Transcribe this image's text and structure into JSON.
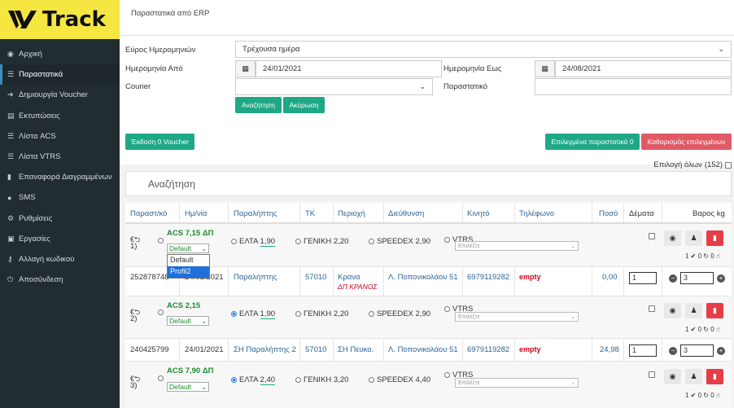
{
  "brand": {
    "name": "Track"
  },
  "nav": [
    {
      "icon": "tachometer-icon",
      "label": "Αρχική",
      "active": false
    },
    {
      "icon": "list-icon",
      "label": "Παραστατικά",
      "active": true
    },
    {
      "icon": "arrow-icon",
      "label": "Δημιουργία Voucher",
      "active": false
    },
    {
      "icon": "printer-icon",
      "label": "Εκτυπώσεις",
      "active": false
    },
    {
      "icon": "list-icon",
      "label": "Λίστα ACS",
      "active": false
    },
    {
      "icon": "list-icon",
      "label": "Λίστα VTRS",
      "active": false
    },
    {
      "icon": "trash-icon",
      "label": "Επαναφορά Διαγραμμένων",
      "active": false
    },
    {
      "icon": "comment-icon",
      "label": "SMS",
      "active": false
    },
    {
      "icon": "sliders-icon",
      "label": "Ρυθμίσεις",
      "active": false
    },
    {
      "icon": "briefcase-icon",
      "label": "Εργασίες",
      "active": false
    },
    {
      "icon": "key-icon",
      "label": "Αλλαγή κωδικού",
      "active": false
    },
    {
      "icon": "power-icon",
      "label": "Αποσύνδεση",
      "active": false
    }
  ],
  "page": {
    "title": "Παραστατικά από ERP"
  },
  "filters": {
    "range_label": "Εύρος Ημερομηνιών",
    "range_value": "Τρέχουσα ημέρα",
    "from_label": "Ημερομηνία Από",
    "from_value": "24/01/2021",
    "to_label": "Ημερομηνία Εως",
    "to_value": "24/08/2021",
    "courier_label": "Courier",
    "courier_value": "",
    "doc_label": "Παραστατικό",
    "doc_value": "",
    "search_btn": "Αναζήτηση",
    "cancel_btn": "Ακύρωση"
  },
  "actions": {
    "issue": "Έκδοση 0 Voucher",
    "selected": "Επιλεγμένα παραστατικά 0",
    "clear": "Καθαρισμός επιλεγμένων"
  },
  "select_all": {
    "label": "Επιλογή όλων",
    "count": "(152)"
  },
  "search": {
    "placeholder": "Αναζήτηση"
  },
  "table": {
    "headers": [
      "Παραστ/κό",
      "Ημ/νία",
      "Παραλήπτης",
      "ΤΚ",
      "Περιοχή",
      "Διεύθυνση",
      "Κινητό",
      "Τηλέφωνο",
      "Ποσό",
      "Δέματα",
      "Βαρος kg"
    ],
    "rows": [
      {
        "num": "1)",
        "offer": "ACS 7,15 ΔΠ",
        "profile": "Default",
        "couriers": [
          {
            "name": "ΕΛΤΑ",
            "price": "1,90",
            "on": false
          },
          {
            "name": "ΓΕΝΙΚΗ",
            "price": "2,20",
            "on": false
          },
          {
            "name": "SPEEDEX",
            "price": "2,90",
            "on": false
          },
          {
            "name": "VTRS",
            "price": "",
            "on": false
          }
        ],
        "vtrs_placeholder": "Επιλέξτε",
        "status": "1 ✔ 0 ↻ 0 ☝",
        "doc": "252878748",
        "date": "24/01/2021",
        "recipient": "Παραλήπτης",
        "tk": "57010",
        "area": "Κρανα",
        "area_note": "ΔΠ ΚΡΑΝΟΣ",
        "addr": "Λ. Ποπονικολάου 51",
        "mobile": "6979119282",
        "phone": "empty",
        "amount": "0,00",
        "parcels": "1",
        "weight": "3"
      },
      {
        "num": "2)",
        "offer": "ACS 2,15",
        "profile": "Default",
        "couriers": [
          {
            "name": "ΕΛΤΑ",
            "price": "1,90",
            "on": true
          },
          {
            "name": "ΓΕΝΙΚΗ",
            "price": "2,20",
            "on": false
          },
          {
            "name": "SPEEDEX",
            "price": "2,90",
            "on": false
          },
          {
            "name": "VTRS",
            "price": "",
            "on": false
          }
        ],
        "vtrs_placeholder": "Επιλέξτε",
        "status": "1 ✔ 0 ↻ 0 ☝",
        "doc": "240425799",
        "date": "24/01/2021",
        "recipient": "ΣΗ Παραλήπτης 2",
        "tk": "57010",
        "area": "ΣΗ Πευκο.",
        "area_note": "",
        "addr": "Λ. Ποπονικολάου 51",
        "mobile": "6979119282",
        "phone": "empty",
        "amount": "24,98",
        "parcels": "1",
        "weight": "3"
      },
      {
        "num": "3)",
        "offer": "ACS 7,90 ΔΠ",
        "profile": "Default",
        "couriers": [
          {
            "name": "ΕΛΤΑ",
            "price": "2,40",
            "on": true
          },
          {
            "name": "ΓΕΝΙΚΗ",
            "price": "3,20",
            "on": false
          },
          {
            "name": "SPEEDEX",
            "price": "4,40",
            "on": false
          },
          {
            "name": "VTRS",
            "price": "",
            "on": false
          }
        ],
        "vtrs_placeholder": "Επιλέξτε",
        "status": "1 ✔ 0 ↻ 0 ☝"
      }
    ]
  },
  "profile_dropdown": {
    "options": [
      "Default",
      "Profil2"
    ],
    "highlighted": 1
  }
}
